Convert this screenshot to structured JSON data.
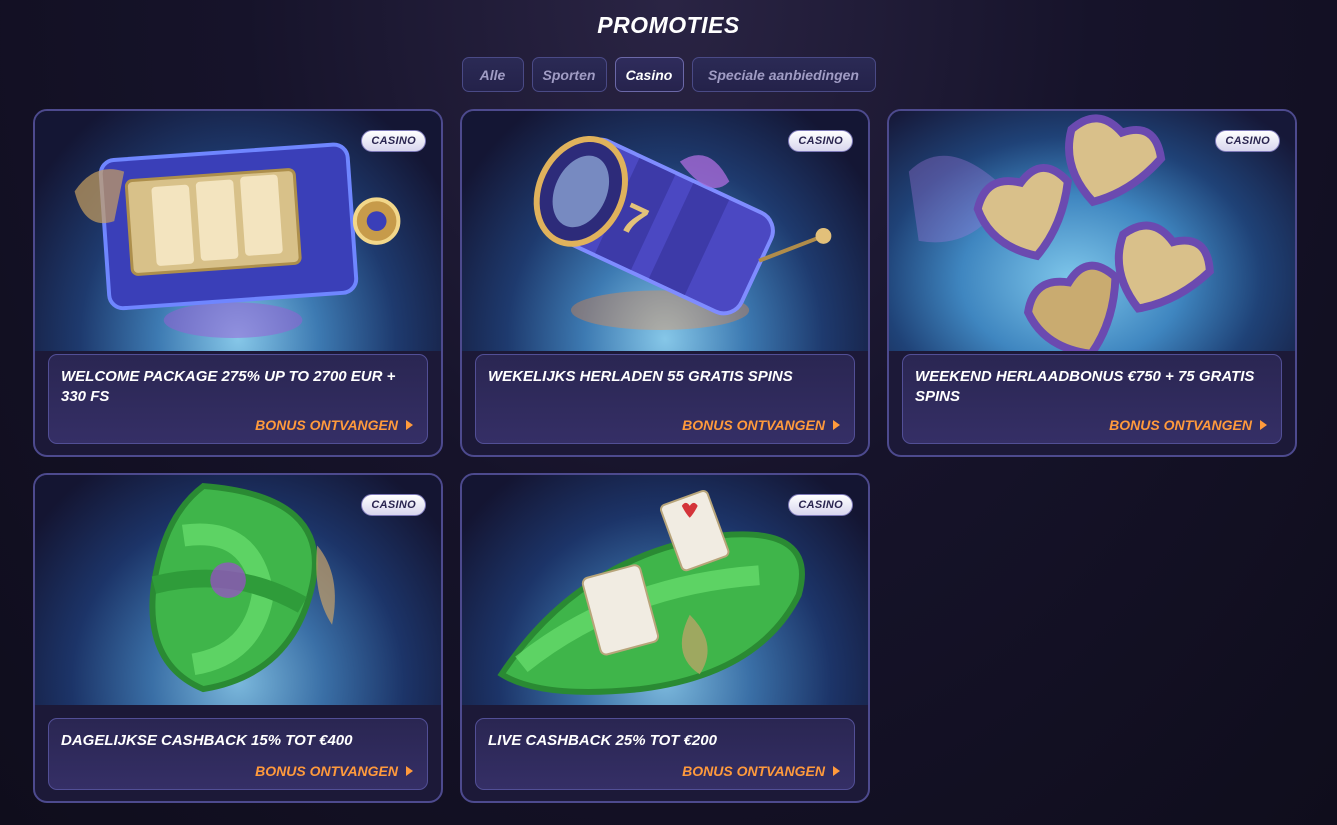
{
  "page": {
    "title": "PROMOTIES"
  },
  "tabs": [
    {
      "label": "Alle",
      "active": false
    },
    {
      "label": "Sporten",
      "active": false
    },
    {
      "label": "Casino",
      "active": true
    },
    {
      "label": "Speciale aanbiedingen",
      "active": false
    }
  ],
  "promos": [
    {
      "badge": "CASINO",
      "title": "WELCOME PACKAGE 275% UP TO 2700 EUR + 330 FS",
      "cta": "BONUS ONTVANGEN",
      "image": "slot-machine-reel"
    },
    {
      "badge": "CASINO",
      "title": "WEKELIJKS HERLADEN 55 GRATIS SPINS",
      "cta": "BONUS ONTVANGEN",
      "image": "slot-reel-777"
    },
    {
      "badge": "CASINO",
      "title": "WEEKEND HERLAADBONUS €750 + 75 GRATIS SPINS",
      "cta": "BONUS ONTVANGEN",
      "image": "gold-hearts"
    },
    {
      "badge": "CASINO",
      "title": "DAGELIJKSE CASHBACK 15% TOT €400",
      "cta": "BONUS ONTVANGEN",
      "image": "cash-ribbon"
    },
    {
      "badge": "CASINO",
      "title": "LIVE CASHBACK 25% TOT €200",
      "cta": "BONUS ONTVANGEN",
      "image": "cash-cards-ribbon"
    }
  ],
  "colors": {
    "accent": "#ff9a3c",
    "border": "#4d4a8e",
    "background": "#16132a"
  }
}
